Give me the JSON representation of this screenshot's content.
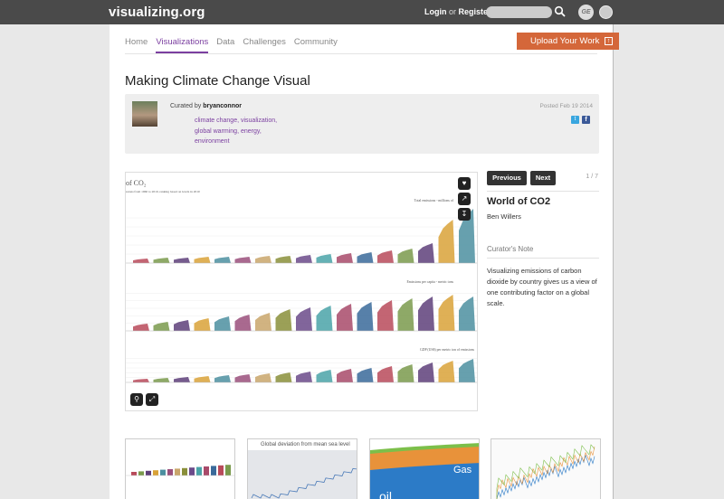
{
  "header": {
    "logo": "visualizing.org",
    "login": "Login",
    "or": "or",
    "register": "Register",
    "search_placeholder": "",
    "partner_logo": "GE"
  },
  "nav": {
    "items": [
      {
        "label": "Home"
      },
      {
        "label": "Visualizations",
        "active": true
      },
      {
        "label": "Data"
      },
      {
        "label": "Challenges"
      },
      {
        "label": "Community"
      }
    ]
  },
  "upload_button": "Upload Your Work",
  "page_title": "Making Climate Change Visual",
  "curator": {
    "prefix": "Curated by",
    "name": "bryanconnor",
    "posted": "Posted Feb 19 2014",
    "tags": "climate change, visualization, global warming, energy, environment",
    "twitter_glyph": "t",
    "facebook_glyph": "f"
  },
  "viz": {
    "title_fragment": "of CO₂",
    "subtitle_fragment": "ssions from 1960 to 2010, ranking based on levels in 2010",
    "panel1_label": "Total emissions - millions of",
    "panel2_label": "Emissions per capita - metric tons",
    "panel3_label": "GDP (US$) per metric ton of emissions",
    "accent_colors": [
      "#b84a5a",
      "#7a9a4c",
      "#5e3f7a",
      "#d9a238",
      "#4c8fa0",
      "#9a4f7b",
      "#c9a66b",
      "#8a8f3a",
      "#6b4a8a",
      "#4aa3a8",
      "#a84a6a",
      "#3a6a9a"
    ]
  },
  "panel": {
    "previous": "Previous",
    "next": "Next",
    "pager": "1 / 7",
    "work_title": "World of CO2",
    "work_author": "Ben Willers",
    "note_heading": "Curator's Note",
    "note_body": "Visualizing emissions of carbon dioxide by country gives us a view of one contributing factor on a global scale."
  },
  "thumbnails": [
    {
      "caption": ""
    },
    {
      "caption": "Global deviation from mean sea level"
    },
    {
      "caption": "",
      "labels": [
        "Gas",
        "oil"
      ]
    },
    {
      "caption": ""
    }
  ],
  "icons": [
    "search-icon",
    "heart-icon",
    "share-icon",
    "download-icon",
    "zoom-icon",
    "fullscreen-icon",
    "upload-icon",
    "twitter-icon",
    "facebook-icon"
  ]
}
